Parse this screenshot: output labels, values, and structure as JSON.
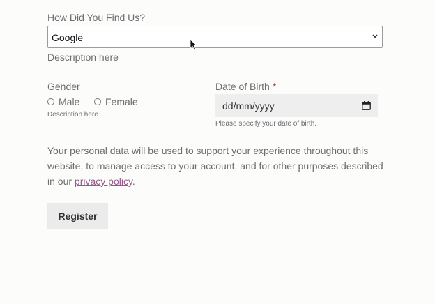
{
  "find_us": {
    "label": "How Did You Find Us?",
    "selected": "Google",
    "description": "Description here"
  },
  "gender": {
    "label": "Gender",
    "options": [
      "Male",
      "Female"
    ],
    "description": "Description here"
  },
  "dob": {
    "label": "Date of Birth",
    "required_mark": "*",
    "placeholder": "dd/mm/yyyy",
    "help": "Please specify your date of birth."
  },
  "privacy": {
    "text": "Your personal data will be used to support your experience throughout this website, to manage access to your account, and for other purposes described in our ",
    "link": "privacy policy",
    "end": "."
  },
  "register_label": "Register",
  "colors": {
    "link": "#96588a",
    "required": "#c0392b",
    "button_bg": "#ebebeb"
  },
  "icons": [
    "chevron-down-icon",
    "calendar-icon",
    "mouse-cursor-icon"
  ]
}
